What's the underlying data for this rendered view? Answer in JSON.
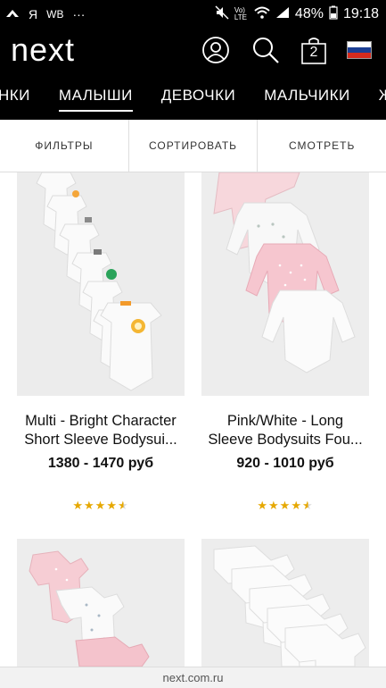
{
  "status_bar": {
    "left_items": [
      "Я",
      "WB",
      "···"
    ],
    "battery": "48%",
    "time": "19:18",
    "lte_label": "Vo) LTE"
  },
  "header": {
    "logo": "next",
    "bag_count": "2",
    "flag_colors": [
      "#ffffff",
      "#1c3f94",
      "#d52b1e"
    ]
  },
  "nav": {
    "items": [
      "НКИ",
      "МАЛЫШИ",
      "ДЕВОЧКИ",
      "МАЛЬЧИКИ",
      "Ж"
    ],
    "active_index": 1
  },
  "tools": {
    "filters": "ФИЛЬТРЫ",
    "sort": "СОРТИРОВАТЬ",
    "view": "СМОТРЕТЬ"
  },
  "products": [
    {
      "name_line1": "Multi - Bright Character",
      "name_line2": "Short Sleeve Bodysui...",
      "price": "1380 - 1470 руб",
      "rating": 4.5
    },
    {
      "name_line1": "Pink/White - Long",
      "name_line2": "Sleeve Bodysuits Fou...",
      "price": "920 - 1010 руб",
      "rating": 4.5
    }
  ],
  "footer": {
    "url": "next.com.ru"
  },
  "colors": {
    "header_bg": "#000000",
    "star": "#e6a800"
  }
}
